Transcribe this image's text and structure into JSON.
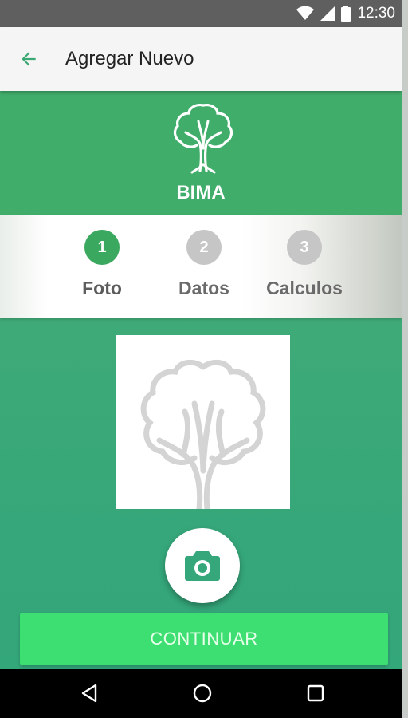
{
  "status_bar": {
    "time": "12:30",
    "icons": [
      "wifi-icon",
      "signal-icon",
      "battery-icon"
    ]
  },
  "app_bar": {
    "title": "Agregar Nuevo",
    "back_icon": "arrow-back-icon"
  },
  "brand": {
    "name": "BIMA",
    "logo_icon": "tree-icon"
  },
  "stepper": {
    "steps": [
      {
        "number": "1",
        "label": "Foto",
        "state": "active"
      },
      {
        "number": "2",
        "label": "Datos",
        "state": "inactive"
      },
      {
        "number": "3",
        "label": "Calculos",
        "state": "inactive"
      }
    ]
  },
  "content": {
    "photo_placeholder_icon": "tree-placeholder-icon",
    "camera_icon": "camera-icon",
    "continue_label": "CONTINUAR"
  },
  "nav_bar": {
    "icons": [
      "nav-back-icon",
      "nav-home-icon",
      "nav-recents-icon"
    ]
  },
  "colors": {
    "primary_green": "#41ad6b",
    "content_green": "#36a77a",
    "button_green": "#3ddf72",
    "step_active": "#3aa85f",
    "step_inactive": "#c6c6c6"
  }
}
